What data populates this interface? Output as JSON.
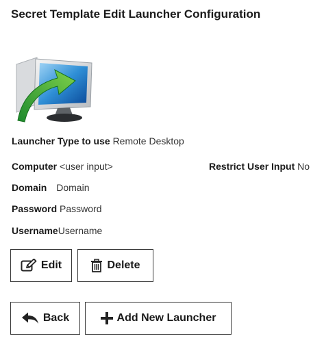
{
  "page": {
    "title": "Secret Template Edit Launcher Configuration"
  },
  "launcher": {
    "icon": "remote-desktop-icon",
    "type_label": "Launcher Type to use",
    "type_value": "Remote Desktop"
  },
  "fields": {
    "computer": {
      "label": "Computer",
      "value": "<user input>"
    },
    "restrict": {
      "label": "Restrict User Input",
      "value": "No"
    },
    "domain": {
      "label": "Domain",
      "value": "Domain"
    },
    "password": {
      "label": "Password",
      "value": "Password"
    },
    "username": {
      "label": "Username",
      "value": "Username"
    }
  },
  "actions": {
    "edit_label": "Edit",
    "delete_label": "Delete",
    "back_label": "Back",
    "add_label": "Add New Launcher"
  },
  "icons": {
    "edit": "edit-icon",
    "delete": "trash-icon",
    "back": "back-arrow-icon",
    "add": "plus-icon"
  }
}
